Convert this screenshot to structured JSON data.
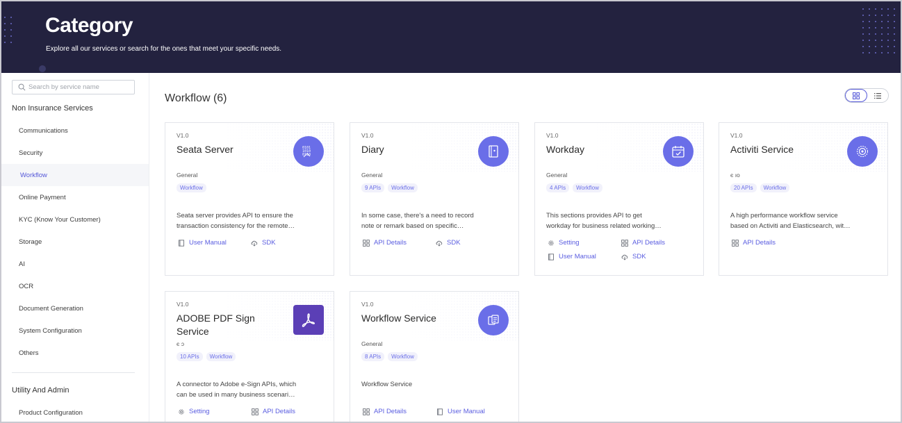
{
  "header": {
    "title": "Category",
    "subtitle": "Explore all our services or search for the ones that meet your specific needs."
  },
  "sidebar": {
    "search_placeholder": "Search by service name",
    "group1_title": "Non Insurance Services",
    "items": [
      {
        "label": "Communications"
      },
      {
        "label": "Security"
      },
      {
        "label": "Workflow",
        "active": true
      },
      {
        "label": "Online Payment"
      },
      {
        "label": "KYC (Know Your Customer)"
      },
      {
        "label": "Storage"
      },
      {
        "label": "AI"
      },
      {
        "label": "OCR"
      },
      {
        "label": "Document Generation"
      },
      {
        "label": "System Configuration"
      },
      {
        "label": "Others"
      }
    ],
    "group2_title": "Utility And Admin",
    "group2_items": [
      {
        "label": "Product Configuration"
      }
    ]
  },
  "main": {
    "title": "Workflow (6)",
    "view_modes": [
      "grid-icon",
      "list-icon"
    ],
    "cards": [
      {
        "version": "V1.0",
        "name": "Seata Server",
        "icon": "binary-code-icon",
        "category": "General",
        "tags": [
          "Workflow"
        ],
        "description_line1": "Seata server provides API to ensure the",
        "description_line2": "transaction consistency for the remote…",
        "links": [
          "User Manual",
          "SDK"
        ]
      },
      {
        "version": "V1.0",
        "name": "Diary",
        "icon": "diary-book-icon",
        "category": "General",
        "tags": [
          "9 APIs",
          "Workflow"
        ],
        "description_line1": "In some case, there's a need to record",
        "description_line2": "note or remark based on specific…",
        "links": [
          "API Details",
          "SDK"
        ]
      },
      {
        "version": "V1.0",
        "name": "Workday",
        "icon": "calendar-check-icon",
        "category": "General",
        "tags": [
          "4 APIs",
          "Workflow"
        ],
        "description_line1": "This sections provides API to get",
        "description_line2": "workday for business related working…",
        "links": [
          "Setting",
          "API Details",
          "User Manual",
          "SDK"
        ]
      },
      {
        "version": "V1.0",
        "name": "Activiti Service",
        "icon": "gear-network-icon",
        "category": "є ıо",
        "tags": [
          "20 APIs",
          "Workflow"
        ],
        "description_line1": "A high performance workflow service",
        "description_line2": "based on Activiti and Elasticsearch, wit…",
        "links": [
          "API Details"
        ]
      },
      {
        "version": "V1.0",
        "name_line1": "ADOBE PDF Sign",
        "name_line2": "Service",
        "icon": "adobe-acrobat-icon",
        "category": "є ɔ",
        "tags": [
          "10 APIs",
          "Workflow"
        ],
        "description_line1": "A connector to Adobe e-Sign APIs, which",
        "description_line2": "can be used in many business scenari…",
        "links": [
          "Setting",
          "API Details"
        ]
      },
      {
        "version": "V1.0",
        "name": "Workflow Service",
        "icon": "workflow-docs-icon",
        "category": "General",
        "tags": [
          "8 APIs",
          "Workflow"
        ],
        "description_line1": "Workflow Service",
        "links": [
          "API Details",
          "User Manual"
        ]
      }
    ]
  },
  "colors": {
    "header_bg": "#23223f",
    "accent": "#5457d8",
    "icon_circle": "#6a6ee8",
    "adobe_icon": "#5b3fb6"
  }
}
